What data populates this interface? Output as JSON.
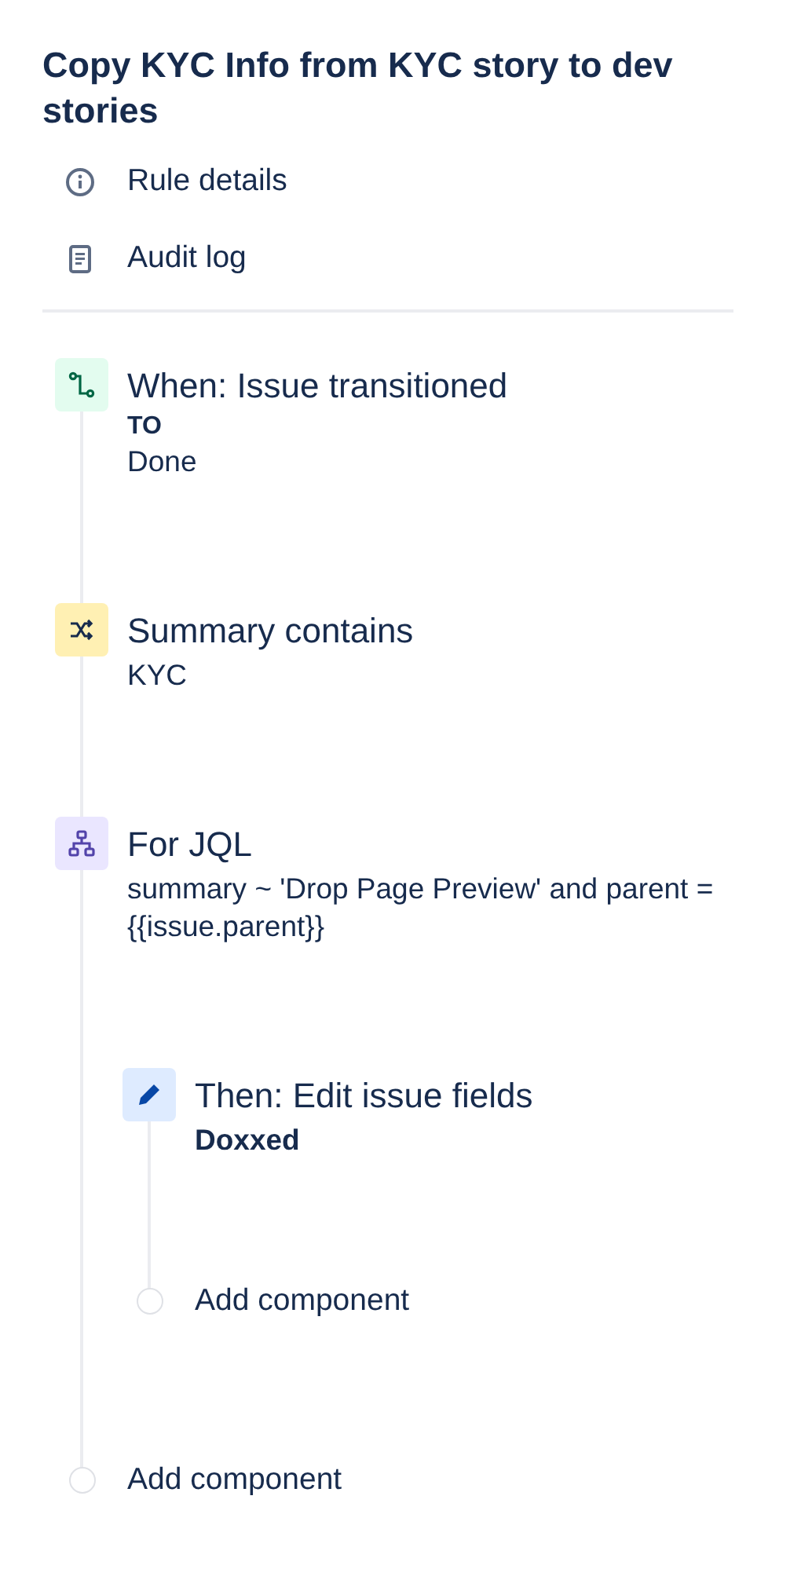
{
  "rule_title": "Copy KYC Info from KYC story to dev stories",
  "menu": [
    {
      "kind": "info",
      "label": "Rule details"
    },
    {
      "kind": "log",
      "label": "Audit log"
    }
  ],
  "components": [
    {
      "kind": "trigger",
      "title": "When: Issue transitioned",
      "details": [
        {
          "kind": "label",
          "text": "TO"
        },
        {
          "kind": "value",
          "text": "Done"
        }
      ]
    },
    {
      "kind": "condition",
      "title": "Summary contains",
      "details": [
        {
          "kind": "value",
          "text": "KYC"
        }
      ]
    },
    {
      "kind": "branch",
      "title": "For JQL",
      "details": [
        {
          "kind": "value",
          "text": "summary ~ 'Drop Page Preview' and parent = {{issue.parent}}"
        }
      ],
      "children": [
        {
          "kind": "action",
          "title": "Then: Edit issue fields",
          "details": [
            {
              "kind": "strong",
              "text": "Doxxed"
            }
          ]
        }
      ],
      "add_label": "Add component"
    }
  ],
  "add_label": "Add component"
}
